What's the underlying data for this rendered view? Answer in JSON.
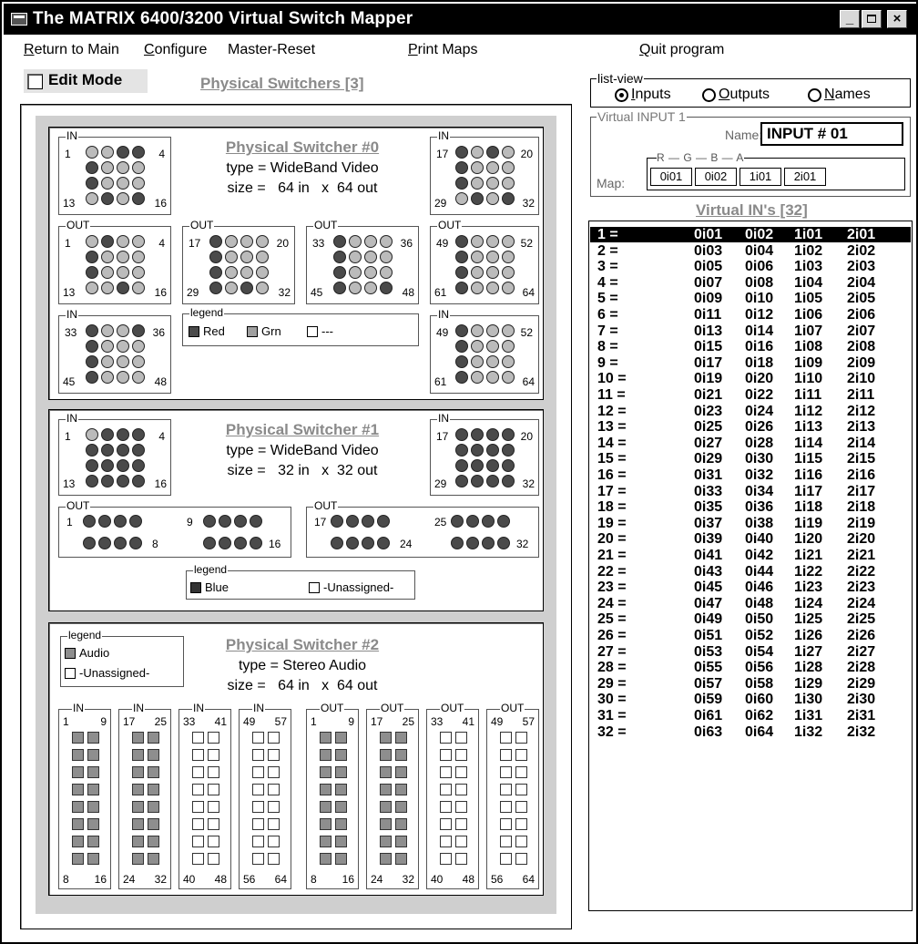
{
  "window": {
    "title": "The MATRIX 6400/3200 Virtual Switch Mapper"
  },
  "menu": {
    "return_main": {
      "u": "R",
      "rest": "eturn to Main"
    },
    "configure": {
      "u": "C",
      "rest": "onfigure"
    },
    "master_reset": "Master-Reset",
    "print_maps": {
      "u": "P",
      "rest": "rint Maps"
    },
    "quit": {
      "u": "Q",
      "rest": "uit program"
    }
  },
  "edit_mode": {
    "label": "Edit Mode",
    "checked": false
  },
  "physical_header": "Physical Switchers [3]",
  "switchers": [
    {
      "title": "Physical Switcher #0",
      "type": "type = WideBand Video",
      "size": "size =   64 in   x  64 out",
      "legend": {
        "caption": "legend",
        "items": [
          {
            "label": "Red",
            "color": "#4a4a4a"
          },
          {
            "label": "Grn",
            "color": "#a0a0a0"
          },
          {
            "label": "---",
            "color": "#ffffff"
          }
        ]
      },
      "groups": [
        {
          "cap": "IN",
          "a": "1",
          "b": "4",
          "c": "13",
          "d": "16"
        },
        {
          "cap": "IN",
          "a": "17",
          "b": "20",
          "c": "29",
          "d": "32"
        },
        {
          "cap": "OUT",
          "a": "1",
          "b": "4",
          "c": "13",
          "d": "16"
        },
        {
          "cap": "OUT",
          "a": "17",
          "b": "20",
          "c": "29",
          "d": "32"
        },
        {
          "cap": "OUT",
          "a": "33",
          "b": "36",
          "c": "45",
          "d": "48"
        },
        {
          "cap": "OUT",
          "a": "49",
          "b": "52",
          "c": "61",
          "d": "64"
        },
        {
          "cap": "IN",
          "a": "33",
          "b": "36",
          "c": "45",
          "d": "48"
        },
        {
          "cap": "IN",
          "a": "49",
          "b": "52",
          "c": "61",
          "d": "64"
        }
      ]
    },
    {
      "title": "Physical Switcher #1",
      "type": "type = WideBand Video",
      "size": "size =   32 in   x  32 out",
      "legend": {
        "caption": "legend",
        "items": [
          {
            "label": "Blue",
            "color": "#333333"
          },
          {
            "label": "-Unassigned-",
            "color": "#ffffff"
          }
        ]
      },
      "groups": [
        {
          "cap": "IN",
          "a": "1",
          "b": "4",
          "c": "13",
          "d": "16"
        },
        {
          "cap": "IN",
          "a": "17",
          "b": "20",
          "c": "29",
          "d": "32"
        },
        {
          "cap": "OUT",
          "a": "1",
          "b": "9",
          "c": "8",
          "d": "16"
        },
        {
          "cap": "OUT",
          "a": "17",
          "b": "25",
          "c": "24",
          "d": "32"
        }
      ]
    },
    {
      "title": "Physical Switcher #2",
      "type": "type = Stereo Audio",
      "size": "size =   64 in   x  64 out",
      "legend": {
        "caption": "legend",
        "items": [
          {
            "label": "Audio",
            "color": "#8e8e8e"
          },
          {
            "label": "-Unassigned-",
            "color": "#ffffff"
          }
        ]
      },
      "groups": [
        {
          "cap": "IN",
          "a": "1",
          "b": "9",
          "c": "8",
          "d": "16",
          "filled": true
        },
        {
          "cap": "IN",
          "a": "17",
          "b": "25",
          "c": "24",
          "d": "32",
          "filled": true
        },
        {
          "cap": "IN",
          "a": "33",
          "b": "41",
          "c": "40",
          "d": "48",
          "filled": false
        },
        {
          "cap": "IN",
          "a": "49",
          "b": "57",
          "c": "56",
          "d": "64",
          "filled": false
        },
        {
          "cap": "OUT",
          "a": "1",
          "b": "9",
          "c": "8",
          "d": "16",
          "filled": true
        },
        {
          "cap": "OUT",
          "a": "17",
          "b": "25",
          "c": "24",
          "d": "32",
          "filled": true
        },
        {
          "cap": "OUT",
          "a": "33",
          "b": "41",
          "c": "40",
          "d": "48",
          "filled": false
        },
        {
          "cap": "OUT",
          "a": "49",
          "b": "57",
          "c": "56",
          "d": "64",
          "filled": false
        }
      ]
    }
  ],
  "list_view": {
    "caption": "list-view",
    "selected": "Inputs",
    "options": [
      {
        "u": "I",
        "rest": "nputs"
      },
      {
        "u": "O",
        "rest": "utputs"
      },
      {
        "u": "N",
        "rest": "ames"
      }
    ]
  },
  "virtual_input": {
    "caption": "Virtual INPUT 1",
    "name_label": "Name:",
    "name_value": "INPUT #  01",
    "map_label": "Map:",
    "map_letters": "R — G — B — A",
    "map": [
      "0i01",
      "0i02",
      "1i01",
      "2i01"
    ]
  },
  "virtual_ins_header": "Virtual IN's [32]",
  "virtual_ins": [
    [
      "1 =",
      "0i01",
      "0i02",
      "1i01",
      "2i01"
    ],
    [
      "2 =",
      "0i03",
      "0i04",
      "1i02",
      "2i02"
    ],
    [
      "3 =",
      "0i05",
      "0i06",
      "1i03",
      "2i03"
    ],
    [
      "4 =",
      "0i07",
      "0i08",
      "1i04",
      "2i04"
    ],
    [
      "5 =",
      "0i09",
      "0i10",
      "1i05",
      "2i05"
    ],
    [
      "6 =",
      "0i11",
      "0i12",
      "1i06",
      "2i06"
    ],
    [
      "7 =",
      "0i13",
      "0i14",
      "1i07",
      "2i07"
    ],
    [
      "8 =",
      "0i15",
      "0i16",
      "1i08",
      "2i08"
    ],
    [
      "9 =",
      "0i17",
      "0i18",
      "1i09",
      "2i09"
    ],
    [
      "10 =",
      "0i19",
      "0i20",
      "1i10",
      "2i10"
    ],
    [
      "11 =",
      "0i21",
      "0i22",
      "1i11",
      "2i11"
    ],
    [
      "12 =",
      "0i23",
      "0i24",
      "1i12",
      "2i12"
    ],
    [
      "13 =",
      "0i25",
      "0i26",
      "1i13",
      "2i13"
    ],
    [
      "14 =",
      "0i27",
      "0i28",
      "1i14",
      "2i14"
    ],
    [
      "15 =",
      "0i29",
      "0i30",
      "1i15",
      "2i15"
    ],
    [
      "16 =",
      "0i31",
      "0i32",
      "1i16",
      "2i16"
    ],
    [
      "17 =",
      "0i33",
      "0i34",
      "1i17",
      "2i17"
    ],
    [
      "18 =",
      "0i35",
      "0i36",
      "1i18",
      "2i18"
    ],
    [
      "19 =",
      "0i37",
      "0i38",
      "1i19",
      "2i19"
    ],
    [
      "20 =",
      "0i39",
      "0i40",
      "1i20",
      "2i20"
    ],
    [
      "21 =",
      "0i41",
      "0i42",
      "1i21",
      "2i21"
    ],
    [
      "22 =",
      "0i43",
      "0i44",
      "1i22",
      "2i22"
    ],
    [
      "23 =",
      "0i45",
      "0i46",
      "1i23",
      "2i23"
    ],
    [
      "24 =",
      "0i47",
      "0i48",
      "1i24",
      "2i24"
    ],
    [
      "25 =",
      "0i49",
      "0i50",
      "1i25",
      "2i25"
    ],
    [
      "26 =",
      "0i51",
      "0i52",
      "1i26",
      "2i26"
    ],
    [
      "27 =",
      "0i53",
      "0i54",
      "1i27",
      "2i27"
    ],
    [
      "28 =",
      "0i55",
      "0i56",
      "1i28",
      "2i28"
    ],
    [
      "29 =",
      "0i57",
      "0i58",
      "1i29",
      "2i29"
    ],
    [
      "30 =",
      "0i59",
      "0i60",
      "1i30",
      "2i30"
    ],
    [
      "31 =",
      "0i61",
      "0i62",
      "1i31",
      "2i31"
    ],
    [
      "32 =",
      "0i63",
      "0i64",
      "1i32",
      "2i32"
    ]
  ],
  "icons": {
    "app": "app-window-icon",
    "minimize": "minimize-icon",
    "maximize": "maximize-icon",
    "close": "close-icon"
  }
}
